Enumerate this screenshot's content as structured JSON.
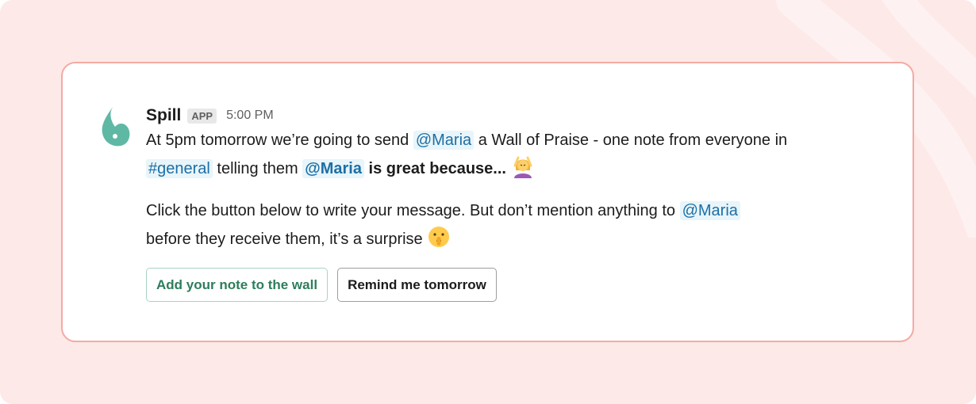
{
  "message": {
    "sender": "Spill",
    "badge": "APP",
    "time": "5:00 PM",
    "p1": {
      "t1": "At 5pm tomorrow we’re going to send ",
      "mention1": "@Maria",
      "t2": " a Wall of Praise - one note from everyone in ",
      "channel": "#general",
      "t3": " telling them ",
      "mention2": "@Maria",
      "bold": " is great because...",
      "emoji": "woman-gesturing-ok-icon"
    },
    "p2": {
      "t1": "Click the button below to write your message. But don’t mention anything to ",
      "mention": "@Maria",
      "t2": " before they receive them, it’s a surprise ",
      "emoji": "shushing-face-icon"
    }
  },
  "buttons": {
    "primary": "Add your note to the wall",
    "secondary": "Remind me tomorrow"
  },
  "colors": {
    "background": "#fde9e7",
    "card_border": "#f3aaa3",
    "avatar": "#5fb8a4",
    "mention_text": "#1d6fa5",
    "mention_bg": "#e8f5fa",
    "primary_button_text": "#2e7d5b"
  }
}
